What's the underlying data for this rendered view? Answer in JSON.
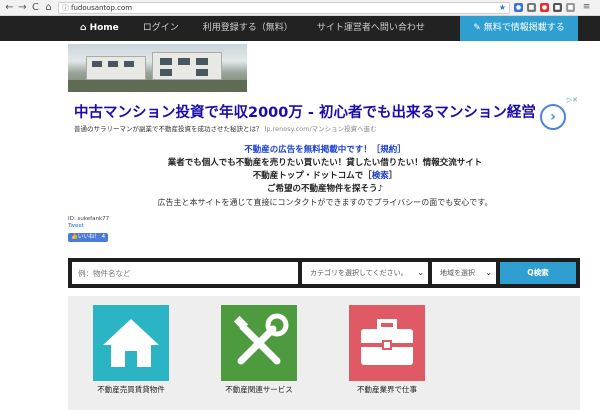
{
  "browser": {
    "url": "fudousantop.com",
    "back": "←",
    "forward": "→",
    "reload": "C",
    "home": "⌂"
  },
  "nav": {
    "home": "Home",
    "login": "ログイン",
    "register": "利用登録する（無料）",
    "contact": "サイト運営者へ問い合わせ",
    "post_button": "無料で情報掲載する"
  },
  "ad": {
    "title": "中古マンション投資で年収2000万 - 初心者でも出来るマンション経営",
    "description": "普通のサラリーマンが副業で不動産投資を成功させた秘訣とは？ ",
    "display_url": "lp.renosy.com/マンション投資へ進む"
  },
  "notice": {
    "line1_text": "不動産の広告を無料掲載中です！［",
    "line1_link": "規約",
    "line1_end": "］",
    "line2": "業者でも個人でも不動産を売りたい買いたい！貸したい借りたい！情報交流サイト",
    "line3_text": "不動産トップ・ドットコムで［",
    "line3_link": "検索",
    "line3_end": "］",
    "line4": "ご希望の不動産物件を探そう♪",
    "line5": "広告主と本サイトを通じて直接にコンタクトができますのでプライバシーの面でも安心です。"
  },
  "meta": {
    "id": "ID: sukefank77",
    "tweet": "Tweet",
    "like": "いいね！ 4"
  },
  "search": {
    "placeholder": "例：物件名など",
    "category": "カテゴリを選択してください。",
    "area": "地域を選択",
    "button": "Q検索"
  },
  "categories": [
    {
      "label": "不動産売買賃貸物件",
      "color": "#2bb5c4",
      "icon": "house-icon"
    },
    {
      "label": "不動産関連サービス",
      "color": "#4e9a3e",
      "icon": "tools-icon"
    },
    {
      "label": "不動産業界で仕事",
      "color": "#e05a66",
      "icon": "briefcase-icon"
    }
  ]
}
